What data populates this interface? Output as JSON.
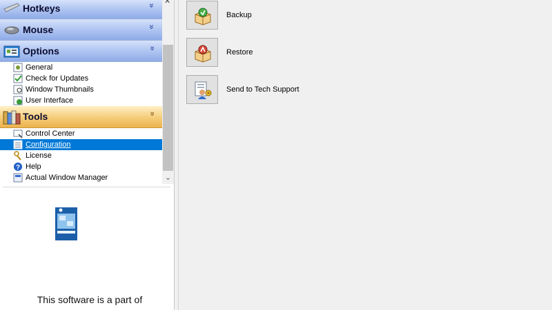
{
  "tree": {
    "groups": [
      {
        "label": "Hotkeys",
        "icon": "keyboard-icon",
        "chevron": "»"
      },
      {
        "label": "Mouse",
        "icon": "mouse-icon",
        "chevron": "»"
      },
      {
        "label": "Options",
        "icon": "options-window-icon",
        "chevron": "«",
        "items": [
          {
            "label": "General",
            "icon": "general-settings-icon"
          },
          {
            "label": "Check for Updates",
            "icon": "check-updates-icon"
          },
          {
            "label": "Window Thumbnails",
            "icon": "window-thumbnails-icon"
          },
          {
            "label": "User Interface",
            "icon": "user-interface-icon"
          }
        ]
      },
      {
        "label": "Tools",
        "icon": "tools-books-icon",
        "chevron": "«",
        "items": [
          {
            "label": "Control Center",
            "icon": "control-center-icon"
          },
          {
            "label": "Configuration",
            "icon": "configuration-icon",
            "selected": true
          },
          {
            "label": "License",
            "icon": "license-key-icon"
          },
          {
            "label": "Help",
            "icon": "help-icon"
          },
          {
            "label": "Actual Window Manager",
            "icon": "app-window-icon"
          }
        ]
      }
    ]
  },
  "promo": {
    "text": "This software is a part of"
  },
  "actions": [
    {
      "label": "Backup",
      "icon": "backup-box-icon"
    },
    {
      "label": "Restore",
      "icon": "restore-box-icon"
    },
    {
      "label": "Send to Tech Support",
      "icon": "send-support-icon"
    }
  ],
  "colors": {
    "selection": "#0078d7",
    "group_blue": "#b2c7f2",
    "group_orange": "#f6cf7f"
  }
}
